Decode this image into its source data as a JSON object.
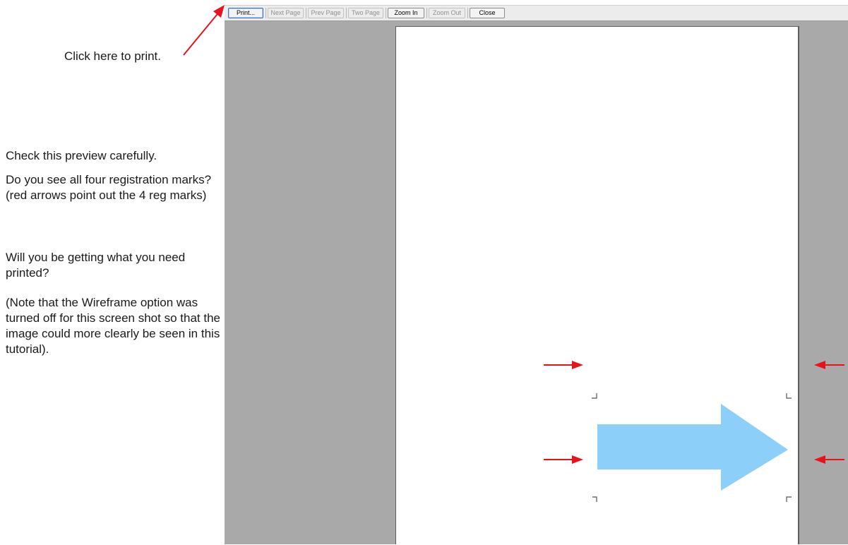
{
  "toolbar": {
    "print_label": "Print...",
    "next_page_label": "Next Page",
    "prev_page_label": "Prev Page",
    "two_page_label": "Two Page",
    "zoom_in_label": "Zoom In",
    "zoom_out_label": "Zoom Out",
    "close_label": "Close"
  },
  "annotations": {
    "click_here": "Click here to print.",
    "check_preview": "Check this preview carefully.",
    "registration_question": "Do you see all four registration marks? (red arrows point out the 4 reg marks)",
    "printed_question": "Will you be getting what you need printed?",
    "wireframe_note": "(Note that the Wireframe option was turned off for this screen shot so that the image could more clearly be seen in this tutorial)."
  },
  "colors": {
    "annotation_arrow": "#e8121d",
    "artwork_fill": "#8ccff9",
    "preview_background": "#a9a9a9",
    "page": "#ffffff"
  }
}
